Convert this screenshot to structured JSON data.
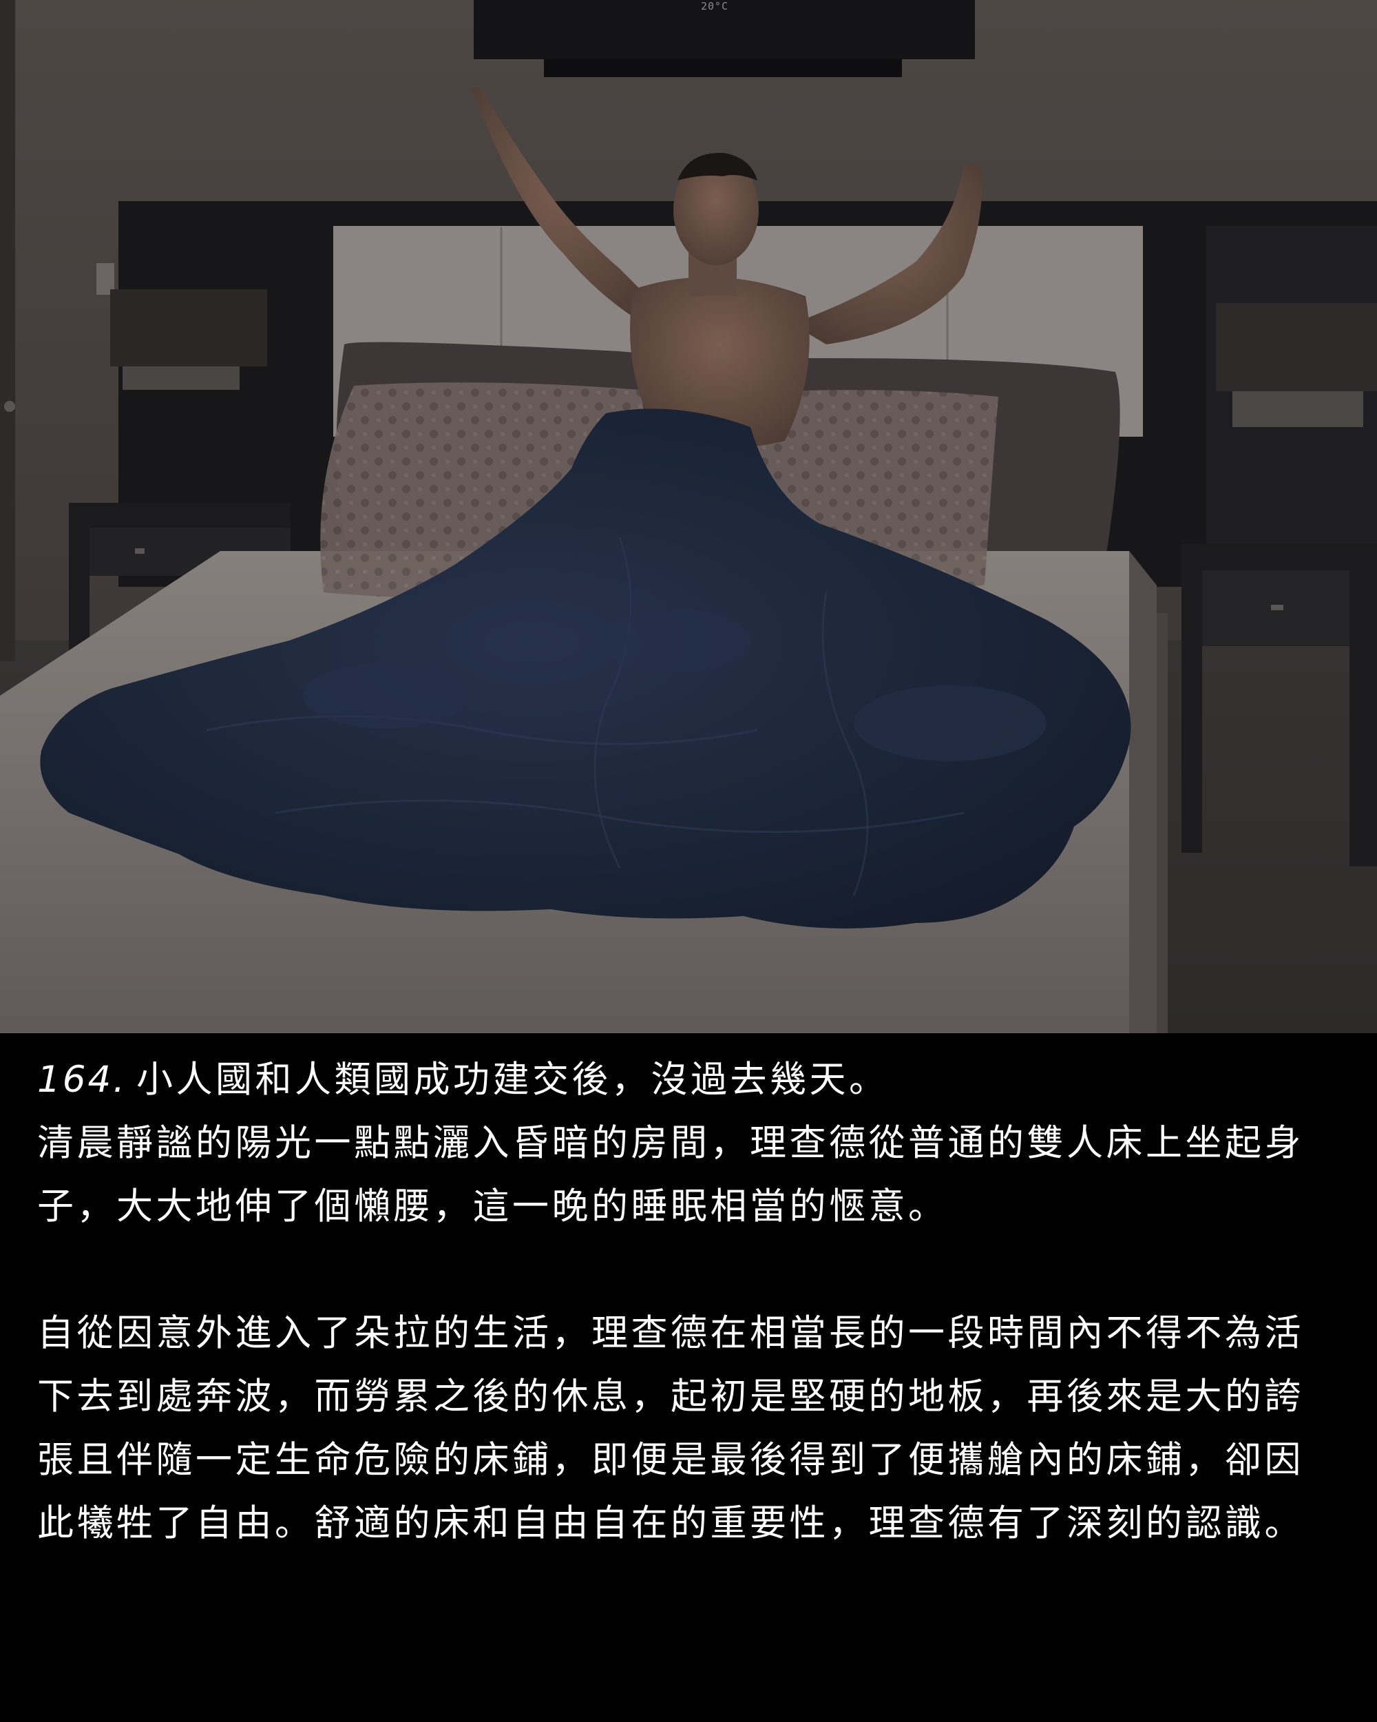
{
  "scene": {
    "ac_display": "20°C",
    "colors": {
      "wall": "#4a4442",
      "headboard_frame": "#17171a",
      "headboard_panel": "#8c8784",
      "duvet": "#1c2637",
      "mattress": "#7a7472",
      "floor": "#3b3938",
      "pillow": "#6e615f",
      "skin": "#6e5548"
    },
    "icons": [
      "air-conditioner",
      "bed",
      "lamp",
      "nightstand",
      "pillow",
      "duvet",
      "person-stretching"
    ]
  },
  "caption": {
    "episode_number": "164.",
    "line_intro": "小人國和人類國成功建交後，沒過去幾天。",
    "paragraph_1": "清晨靜謐的陽光一點點灑入昏暗的房間，理查德從普通的雙人床上坐起身子，大大地伸了個懶腰，這一晚的睡眠相當的愜意。",
    "paragraph_2": "自從因意外進入了朵拉的生活，理查德在相當長的一段時間內不得不為活下去到處奔波，而勞累之後的休息，起初是堅硬的地板，再後來是大的誇張且伴隨一定生命危險的床鋪，即便是最後得到了便攜艙內的床鋪，卻因此犧牲了自由。舒適的床和自由自在的重要性，理查德有了深刻的認識。"
  }
}
